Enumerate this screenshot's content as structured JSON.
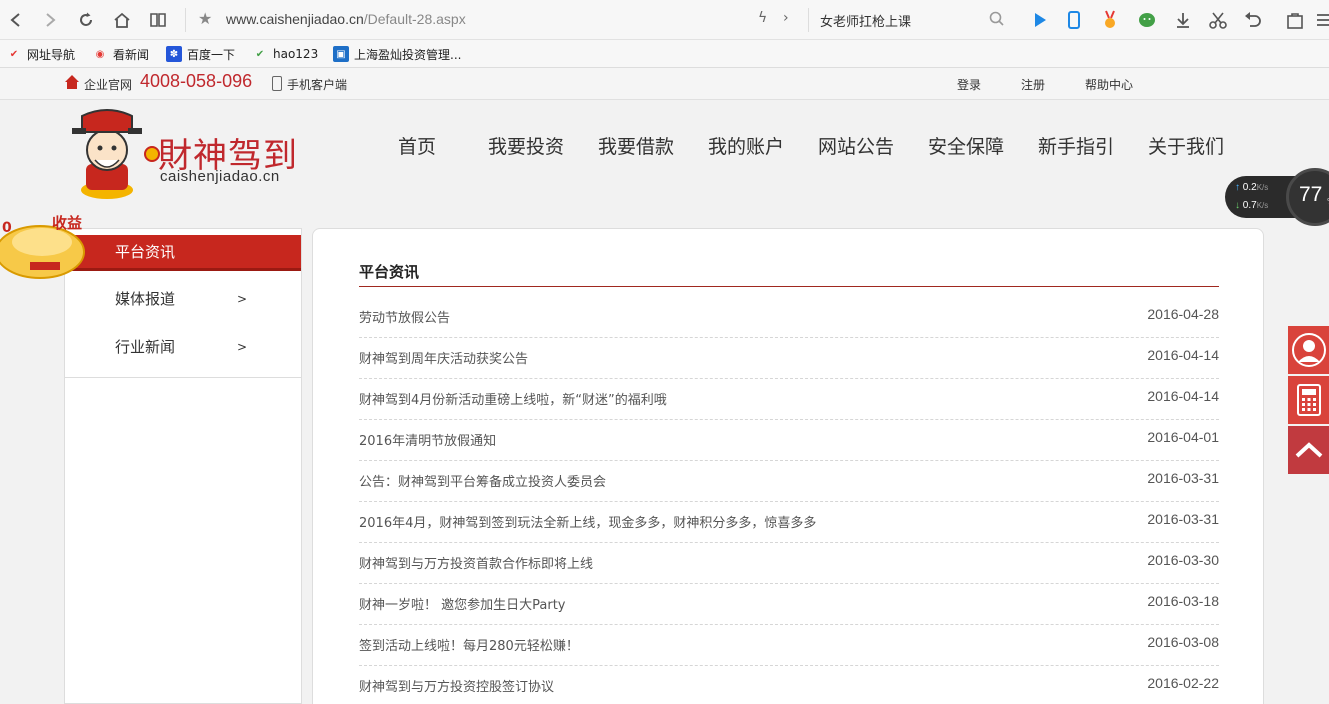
{
  "browser": {
    "url_main": "www.caishenjiadao.cn",
    "url_path": "/Default-28.aspx",
    "search_text": "女老师扛枪上课"
  },
  "bookmarks": [
    {
      "label": "网址导航",
      "icon": "hao-icon"
    },
    {
      "label": "看新闻",
      "icon": "weibo-icon"
    },
    {
      "label": "百度一下",
      "icon": "baidu-paw-icon"
    },
    {
      "label": "hao123",
      "icon": "hao123-icon"
    },
    {
      "label": "上海盈灿投资管理...",
      "icon": "site-icon"
    }
  ],
  "topbar": {
    "official": "企业官网",
    "phone": "4008-058-096",
    "mobile": "手机客户端",
    "login": "登录",
    "register": "注册",
    "help": "帮助中心"
  },
  "logo": {
    "cn": "財神驾到",
    "en": "caishenjiadao.cn"
  },
  "nav": [
    "首页",
    "我要投资",
    "我要借款",
    "我的账户",
    "网站公告",
    "安全保障",
    "新手指引",
    "关于我们"
  ],
  "speed_widget": {
    "up": "0.2",
    "down": "0.7",
    "unit": "K/s",
    "percent": "77",
    "percent_unit": "%"
  },
  "badge": {
    "text": "收益"
  },
  "sidebar": {
    "active": "平台资讯",
    "items": [
      {
        "label": "媒体报道",
        "arrow": ">"
      },
      {
        "label": "行业新闻",
        "arrow": ">"
      }
    ]
  },
  "panel": {
    "title": "平台资讯",
    "news": [
      {
        "title": "劳动节放假公告",
        "date": "2016-04-28"
      },
      {
        "title": "财神驾到周年庆活动获奖公告",
        "date": "2016-04-14"
      },
      {
        "title": "财神驾到4月份新活动重磅上线啦，新“财迷”的福利哦",
        "date": "2016-04-14"
      },
      {
        "title": "2016年清明节放假通知",
        "date": "2016-04-01"
      },
      {
        "title": "公告：财神驾到平台筹备成立投资人委员会",
        "date": "2016-03-31"
      },
      {
        "title": "2016年4月，财神驾到签到玩法全新上线，现金多多，财神积分多多，惊喜多多",
        "date": "2016-03-31"
      },
      {
        "title": "财神驾到与万方投资首款合作标即将上线",
        "date": "2016-03-30"
      },
      {
        "title": "财神一岁啦！ 邀您参加生日大Party",
        "date": "2016-03-18"
      },
      {
        "title": "签到活动上线啦！每月280元轻松赚！",
        "date": "2016-03-08"
      },
      {
        "title": "财神驾到与万方投资控股签订协议",
        "date": "2016-02-22"
      }
    ]
  },
  "colors": {
    "brand_red": "#c7271e",
    "float_red": "#d9433b"
  }
}
